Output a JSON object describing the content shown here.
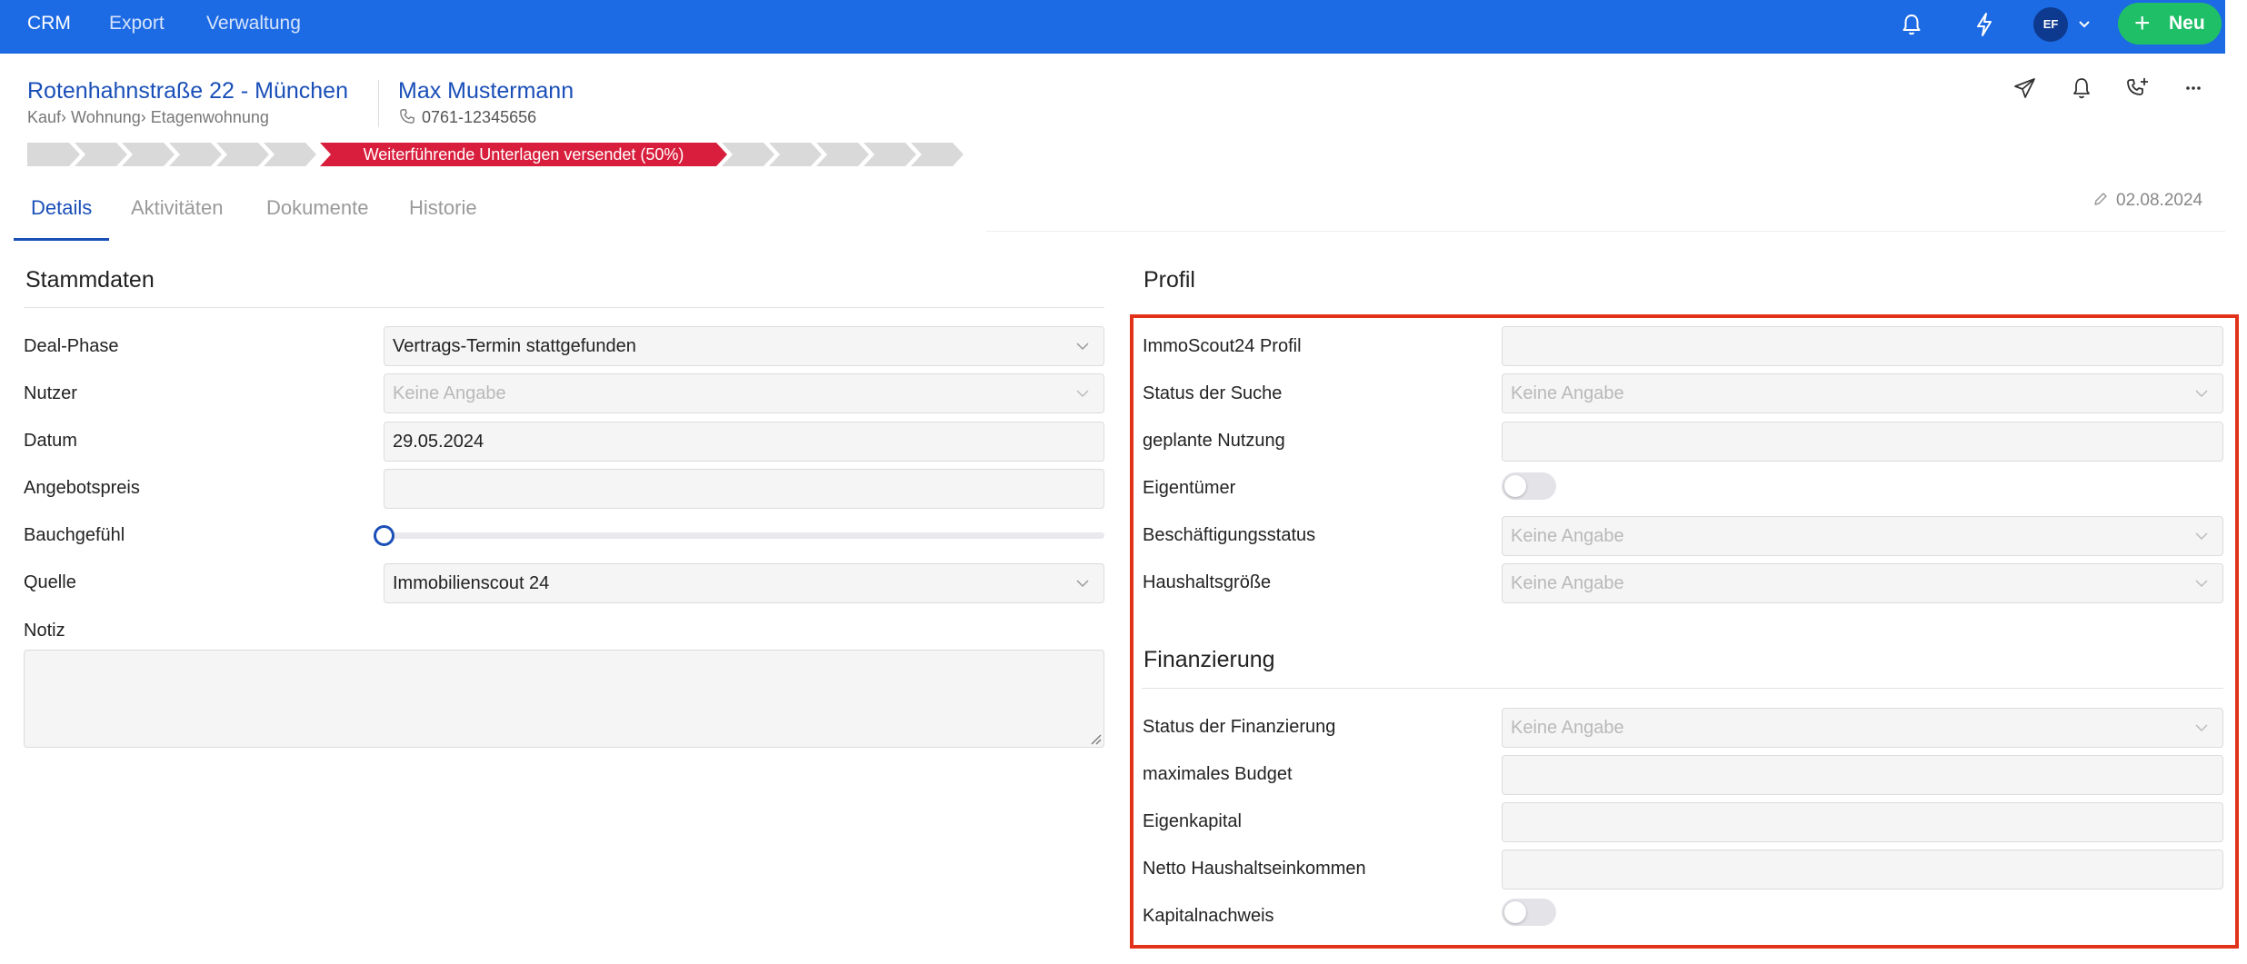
{
  "nav": {
    "items": [
      "CRM",
      "Export",
      "Verwaltung"
    ],
    "avatar_initials": "EF",
    "new_button": "Neu",
    "colors": {
      "bar": "#1c6ae4",
      "new": "#1fbf67"
    }
  },
  "header": {
    "deal_title": "Rotenhahnstraße 22 - München",
    "breadcrumb": "Kauf› Wohnung› Etagenwohnung",
    "contact_name": "Max Mustermann",
    "phone": "0761-12345656",
    "icons": [
      "send-icon",
      "bell-icon",
      "phone-add-icon",
      "more-icon"
    ]
  },
  "stepper": {
    "active_label": "Weiterführende Unterlagen versendet (50%)",
    "active_color": "#d81e3c",
    "steps_before": 6,
    "steps_after": 5
  },
  "tabs": [
    "Details",
    "Aktivitäten",
    "Dokumente",
    "Historie"
  ],
  "active_tab": "Details",
  "modified_date": "02.08.2024",
  "stammdaten": {
    "title": "Stammdaten",
    "deal_phase": {
      "label": "Deal-Phase",
      "value": "Vertrags-Termin stattgefunden"
    },
    "nutzer": {
      "label": "Nutzer",
      "placeholder": "Keine Angabe"
    },
    "datum": {
      "label": "Datum",
      "value": "29.05.2024"
    },
    "angebotspreis": {
      "label": "Angebotspreis",
      "value": ""
    },
    "bauchgefuehl": {
      "label": "Bauchgefühl",
      "level": 0
    },
    "quelle": {
      "label": "Quelle",
      "value": "Immobilienscout 24"
    },
    "notiz": {
      "label": "Notiz",
      "value": ""
    }
  },
  "profil": {
    "title": "Profil",
    "immoscout_profil": {
      "label": "ImmoScout24 Profil",
      "value": ""
    },
    "status_suche": {
      "label": "Status der Suche",
      "placeholder": "Keine Angabe"
    },
    "geplante_nutzung": {
      "label": "geplante Nutzung",
      "value": ""
    },
    "eigentuemer": {
      "label": "Eigentümer",
      "on": false
    },
    "beschaeftigungsstatus": {
      "label": "Beschäftigungsstatus",
      "placeholder": "Keine Angabe"
    },
    "haushaltsgroesse": {
      "label": "Haushaltsgröße",
      "placeholder": "Keine Angabe"
    }
  },
  "finanzierung": {
    "title": "Finanzierung",
    "status_finanzierung": {
      "label": "Status der Finanzierung",
      "placeholder": "Keine Angabe"
    },
    "maximales_budget": {
      "label": "maximales Budget",
      "value": ""
    },
    "eigenkapital": {
      "label": "Eigenkapital",
      "value": ""
    },
    "netto_haushaltseinkommen": {
      "label": "Netto Haushaltseinkommen",
      "value": ""
    },
    "kapitalnachweis": {
      "label": "Kapitalnachweis",
      "on": false
    }
  },
  "highlight_color": "#e2321a"
}
